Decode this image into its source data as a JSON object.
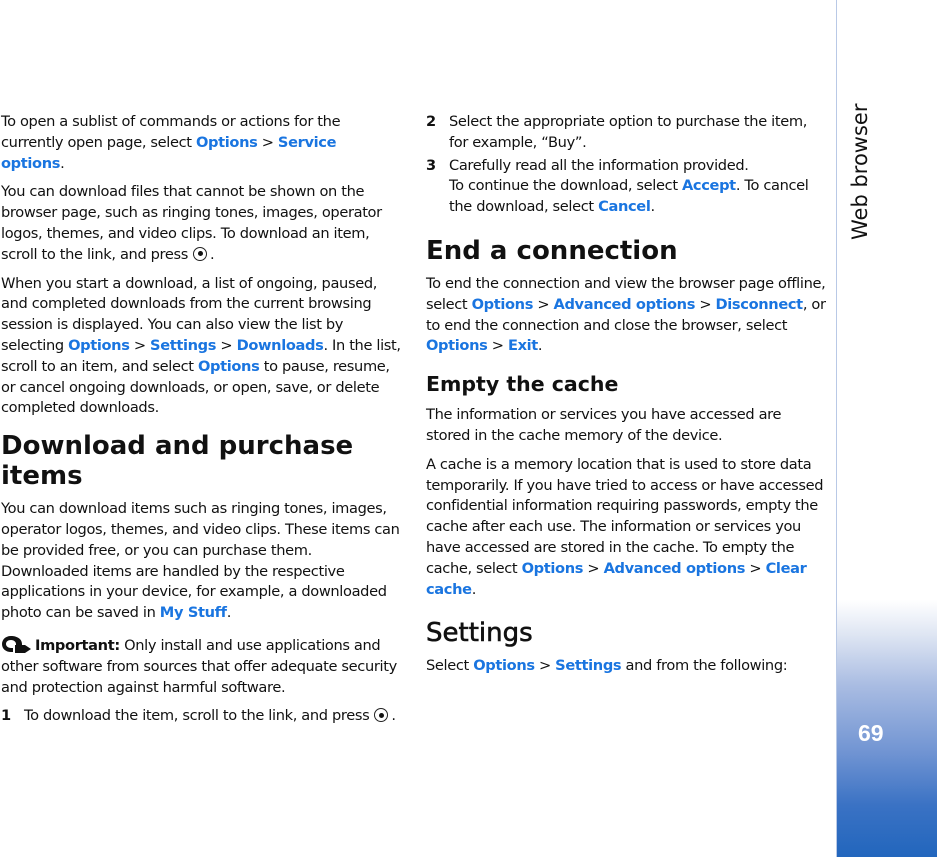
{
  "sidebar": {
    "section_title": "Web browser",
    "page_number": "69",
    "gradient_color": "#2266bd"
  },
  "link_color": "#1a75e0",
  "left_column": {
    "p1": {
      "t1": "To open a sublist of commands or actions for the currently open page, select ",
      "l1": "Options",
      "s1": " > ",
      "l2": "Service options",
      "t2": "."
    },
    "p2": {
      "t1": "You can download files that cannot be shown on the browser page, such as ringing tones, images, operator logos, themes, and video clips. To download an item, scroll to the link, and press",
      "t2": "."
    },
    "p3": {
      "t1": "When you start a download, a list of ongoing, paused, and completed downloads from the current browsing session is displayed. You can also view the list by selecting ",
      "l1": "Options",
      "s1": " > ",
      "l2": "Settings",
      "s2": " > ",
      "l3": "Downloads",
      "t2": ". In the list, scroll to an item, and select ",
      "l4": "Options",
      "t3": " to pause, resume, or cancel ongoing downloads, or open, save, or delete completed downloads."
    },
    "heading_download": "Download and purchase items",
    "p4": {
      "t1": "You can download items such as ringing tones, images, operator logos, themes, and video clips. These items can be provided free, or you can purchase them. Downloaded items are handled by the respective applications in your device, for example, a downloaded photo can be saved in ",
      "l1": "My Stuff",
      "t2": "."
    },
    "important": {
      "label": "Important:",
      "text": " Only install and use applications and other software from sources that offer adequate security and protection against harmful software."
    },
    "step1": {
      "num": "1",
      "text": "To download the item, scroll to the link, and press",
      "end": "."
    }
  },
  "right_column": {
    "step2": {
      "num": "2",
      "text": "Select the appropriate option to purchase the item, for example, “Buy”."
    },
    "step3": {
      "num": "3",
      "text": "Carefully read all the information provided.",
      "t1": "To continue the download, select ",
      "l1": "Accept",
      "t2": ". To cancel the download, select ",
      "l2": "Cancel",
      "t3": "."
    },
    "heading_end": "End a connection",
    "p_end": {
      "t1": "To end the connection and view the browser page offline, select ",
      "l1": "Options",
      "s1": " > ",
      "l2": "Advanced options",
      "s2": " > ",
      "l3": "Disconnect",
      "t2": ", or to end the connection and close the browser, select ",
      "l4": "Options",
      "s3": " > ",
      "l5": "Exit",
      "t3": "."
    },
    "heading_cache": "Empty the cache",
    "p_cache1": "The information or services you have accessed are stored in the cache memory of the device.",
    "p_cache2": {
      "t1": "A cache is a memory location that is used to store data temporarily. If you have tried to access or have accessed confidential information requiring passwords, empty the cache after each use. The information or services you have accessed are stored in the cache. To empty the cache, select ",
      "l1": "Options",
      "s1": " > ",
      "l2": "Advanced options",
      "s2": " > ",
      "l3": "Clear cache",
      "t2": "."
    },
    "heading_settings": "Settings",
    "p_settings": {
      "t1": "Select ",
      "l1": "Options",
      "s1": " > ",
      "l2": "Settings",
      "t2": " and from the following:"
    }
  }
}
